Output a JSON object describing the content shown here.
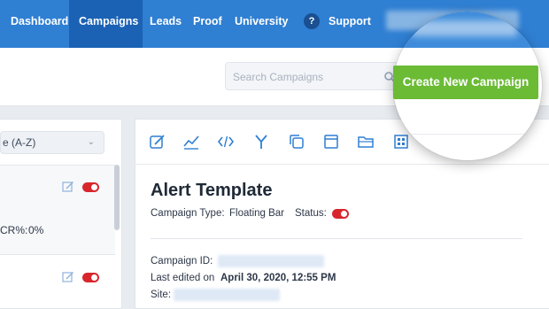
{
  "nav": {
    "items": [
      {
        "label": "Dashboard",
        "active": false
      },
      {
        "label": "Campaigns",
        "active": true
      },
      {
        "label": "Leads",
        "active": false
      },
      {
        "label": "Proof",
        "active": false
      },
      {
        "label": "University",
        "active": false
      }
    ],
    "help_glyph": "?",
    "support_label": "Support"
  },
  "search": {
    "placeholder": "Search Campaigns"
  },
  "create_button_label": "Create New Campaign",
  "list": {
    "sort_value": "e (A-Z)",
    "item1": {
      "cr_label": "CR%:",
      "cr_value": "0%",
      "status_on": true
    },
    "item2": {
      "status_on": true
    }
  },
  "detail": {
    "tools": [
      "edit-icon",
      "analytics-icon",
      "code-icon",
      "split-test-icon",
      "duplicate-icon",
      "window-icon",
      "folder-icon",
      "qr-icon"
    ],
    "title": "Alert Template",
    "campaign_type_label": "Campaign Type:",
    "campaign_type_value": "Floating Bar",
    "status_label": "Status:",
    "campaign_id_label": "Campaign ID:",
    "last_edited_label": "Last edited on",
    "last_edited_value": "April 30, 2020, 12:55 PM",
    "site_label": "Site:"
  },
  "colors": {
    "nav": "#2f7fd3",
    "nav_active": "#1b62b5",
    "accent_green": "#6bbb35",
    "toggle_red": "#d7272d"
  }
}
